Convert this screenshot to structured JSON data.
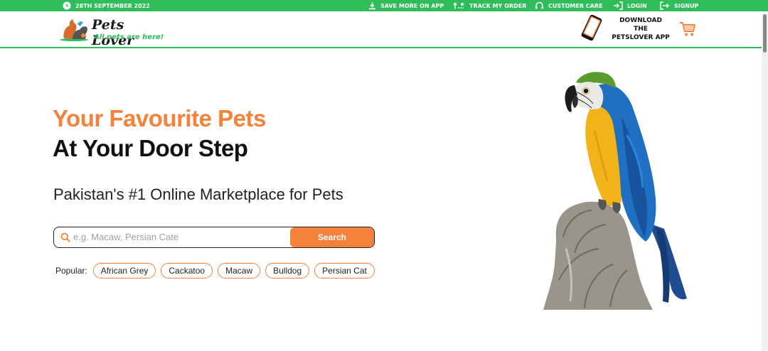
{
  "topbar": {
    "date": "28TH SEPTEMBER 2022",
    "links": [
      {
        "label": "SAVE MORE ON APP",
        "icon": "download-icon"
      },
      {
        "label": "TRACK MY ORDER",
        "icon": "track-icon"
      },
      {
        "label": "CUSTOMER CARE",
        "icon": "headset-icon"
      },
      {
        "label": "LOGIN",
        "icon": "login-icon"
      },
      {
        "label": "SIGNUP",
        "icon": "signup-icon"
      }
    ]
  },
  "header": {
    "brand": "Pets Lover",
    "tagline": "All pets are here!",
    "app_line1": "DOWNLOAD THE",
    "app_line2": "PETSLOVER APP"
  },
  "hero": {
    "title_line1": "Your Favourite Pets",
    "title_line2": "At Your Door Step",
    "subtitle": "Pakistan's #1 Online Marketplace for Pets"
  },
  "search": {
    "placeholder": "e.g. Macaw, Persian Cate",
    "value": "",
    "button": "Search"
  },
  "popular": {
    "label": "Popular:",
    "chips": [
      "African Grey",
      "Cackatoo",
      "Macaw",
      "Bulldog",
      "Persian Cat"
    ]
  },
  "colors": {
    "green": "#2ebd59",
    "orange": "#f5823a",
    "dark": "#111111"
  }
}
